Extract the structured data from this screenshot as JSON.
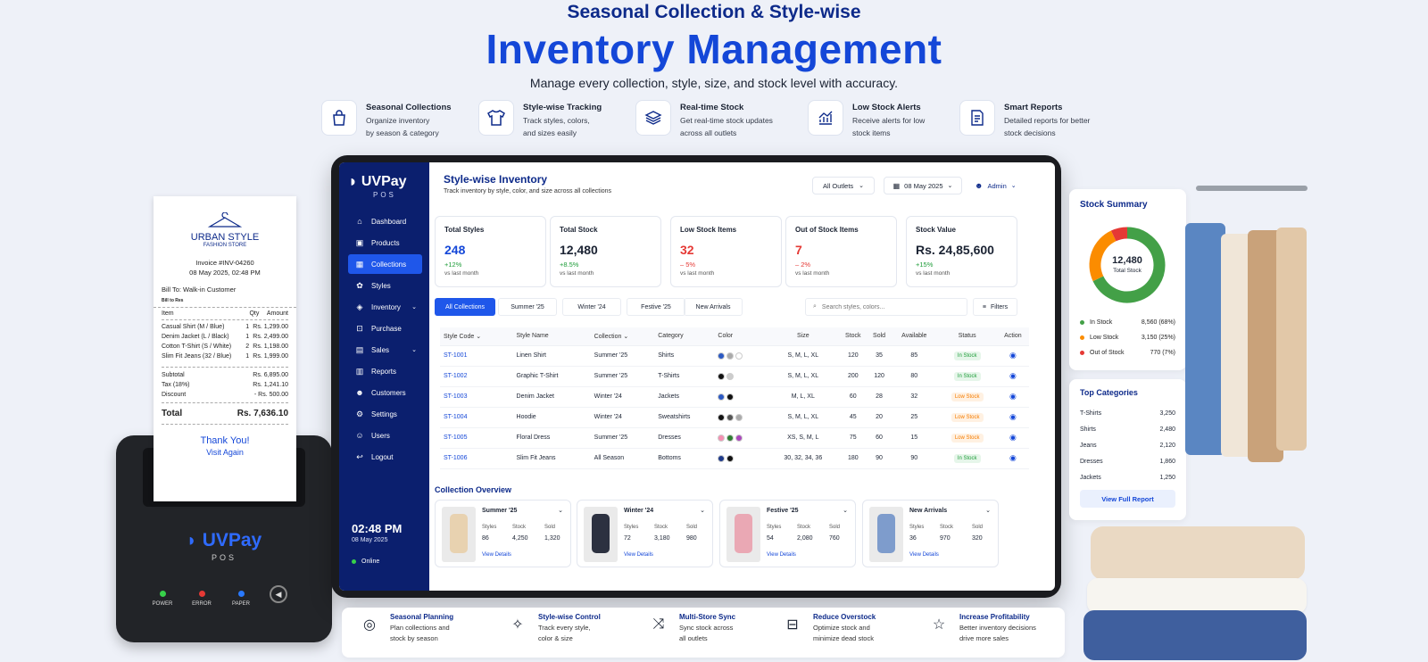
{
  "header": {
    "top_title": "Seasonal Collection & Style-wise",
    "main_title": "Inventory Management",
    "subtitle": "Manage every collection, style, size, and stock level with accuracy."
  },
  "features": [
    {
      "icon": "shopping-bag-icon",
      "title": "Seasonal Collections",
      "line1": "Organize inventory",
      "line2": "by season & category"
    },
    {
      "icon": "tshirt-icon",
      "title": "Style-wise Tracking",
      "line1": "Track styles, colors,",
      "line2": "and sizes easily"
    },
    {
      "icon": "layers-icon",
      "title": "Real-time Stock",
      "line1": "Get real-time stock updates",
      "line2": "across all outlets"
    },
    {
      "icon": "chart-up-icon",
      "title": "Low Stock Alerts",
      "line1": "Receive alerts for low",
      "line2": "stock items"
    },
    {
      "icon": "report-icon",
      "title": "Smart Reports",
      "line1": "Detailed reports for better",
      "line2": "stock decisions"
    }
  ],
  "receipt": {
    "store_name": "URBAN STYLE",
    "store_sub": "FASHION STORE",
    "invoice": "Invoice #INV-04260",
    "datetime": "08 May 2025, 02:48 PM",
    "bill_to": "Bill To: Walk-in Customer",
    "bill_details": "Bill to Res",
    "col_item": "Item",
    "col_qty": "Qty",
    "col_amount": "Amount",
    "items": [
      {
        "name": "Casual Shirt (M / Blue)",
        "qty": "1",
        "amount": "Rs. 1,299.00"
      },
      {
        "name": "Denim Jacket (L / Black)",
        "qty": "1",
        "amount": "Rs. 2,499.00"
      },
      {
        "name": "Cotton T-Shirt (S / White)",
        "qty": "2",
        "amount": "Rs. 1,198.00"
      },
      {
        "name": "Slim Fit Jeans (32 / Blue)",
        "qty": "1",
        "amount": "Rs. 1,999.00"
      }
    ],
    "subtotal_label": "Subtotal",
    "subtotal": "Rs. 6,895.00",
    "tax_label": "Tax (18%)",
    "tax": "Rs. 1,241.10",
    "discount_label": "Discount",
    "discount": "- Rs. 500.00",
    "total_label": "Total",
    "total": "Rs. 7,636.10",
    "thanks": "Thank You!",
    "visit": "Visit Again"
  },
  "printer": {
    "brand": "UVPay",
    "brand_sub": "POS",
    "lights": [
      {
        "label": "POWER",
        "color": "#37d14a"
      },
      {
        "label": "ERROR",
        "color": "#e53935"
      },
      {
        "label": "PAPER",
        "color": "#2979ff"
      }
    ]
  },
  "app": {
    "brand": "UVPay",
    "brand_sub": "POS",
    "nav": [
      {
        "label": "Dashboard",
        "icon": "home-icon",
        "glyph": "⌂",
        "active": false,
        "chevron": false
      },
      {
        "label": "Products",
        "icon": "box-icon",
        "glyph": "▣",
        "active": false,
        "chevron": false
      },
      {
        "label": "Collections",
        "icon": "grid-icon",
        "glyph": "▦",
        "active": true,
        "chevron": false
      },
      {
        "label": "Styles",
        "icon": "palette-icon",
        "glyph": "✿",
        "active": false,
        "chevron": false
      },
      {
        "label": "Inventory",
        "icon": "cube-icon",
        "glyph": "◈",
        "active": false,
        "chevron": true
      },
      {
        "label": "Purchase",
        "icon": "cart-icon",
        "glyph": "⊡",
        "active": false,
        "chevron": false
      },
      {
        "label": "Sales",
        "icon": "tag-icon",
        "glyph": "▤",
        "active": false,
        "chevron": true
      },
      {
        "label": "Reports",
        "icon": "report-icon",
        "glyph": "▥",
        "active": false,
        "chevron": false
      },
      {
        "label": "Customers",
        "icon": "users-icon",
        "glyph": "☻",
        "active": false,
        "chevron": false
      },
      {
        "label": "Settings",
        "icon": "gear-icon",
        "glyph": "⚙",
        "active": false,
        "chevron": false
      },
      {
        "label": "Users",
        "icon": "user-group-icon",
        "glyph": "☺",
        "active": false,
        "chevron": false
      },
      {
        "label": "Logout",
        "icon": "logout-icon",
        "glyph": "↩",
        "active": false,
        "chevron": false
      }
    ],
    "clock_time": "02:48 PM",
    "clock_date": "08 May 2025",
    "status": "Online",
    "page_title": "Style-wise Inventory",
    "page_subtitle": "Track inventory by style, color, and size across all collections",
    "outlet_select": "All Outlets",
    "date_select": "08 May 2025",
    "user": "Admin",
    "stats": [
      {
        "label": "Total Styles",
        "value": "248",
        "change": "+12%",
        "sub": "vs last month",
        "color": "#1447d8",
        "change_color": "#1f9d3a"
      },
      {
        "label": "Total Stock",
        "value": "12,480",
        "change": "+8.5%",
        "sub": "vs last month",
        "color": "#1b2333",
        "change_color": "#1f9d3a"
      },
      {
        "label": "Low Stock Items",
        "value": "32",
        "change": "– 5%",
        "sub": "vs last month",
        "color": "#e53935",
        "change_color": "#e53935"
      },
      {
        "label": "Out of Stock Items",
        "value": "7",
        "change": "– 2%",
        "sub": "vs last month",
        "color": "#e53935",
        "change_color": "#e53935"
      },
      {
        "label": "Stock Value",
        "value": "Rs. 24,85,600",
        "change": "+15%",
        "sub": "vs last month",
        "color": "#1b2333",
        "change_color": "#1f9d3a"
      }
    ],
    "tabs": [
      "All Collections",
      "Summer '25",
      "Winter '24",
      "Festive '25",
      "New Arrivals"
    ],
    "search_placeholder": "Search styles, colors...",
    "filters_label": "Filters",
    "columns": [
      "Style Code",
      "Style Name",
      "Collection",
      "Category",
      "Color",
      "Size",
      "Stock",
      "Sold",
      "Available",
      "Status",
      "Action"
    ],
    "rows": [
      {
        "code": "ST-1001",
        "name": "Linen Shirt",
        "collection": "Summer '25",
        "category": "Shirts",
        "colors": [
          "#2b59c3",
          "#aaaaaa",
          "#ffffff"
        ],
        "size": "S, M, L, XL",
        "stock": "120",
        "sold": "35",
        "available": "85",
        "status": "In Stock",
        "status_type": "in"
      },
      {
        "code": "ST-1002",
        "name": "Graphic T-Shirt",
        "collection": "Summer '25",
        "category": "T-Shirts",
        "colors": [
          "#111111",
          "#cccccc"
        ],
        "size": "S, M, L, XL",
        "stock": "200",
        "sold": "120",
        "available": "80",
        "status": "In Stock",
        "status_type": "in"
      },
      {
        "code": "ST-1003",
        "name": "Denim Jacket",
        "collection": "Winter '24",
        "category": "Jackets",
        "colors": [
          "#2b59c3",
          "#111111"
        ],
        "size": "M, L, XL",
        "stock": "60",
        "sold": "28",
        "available": "32",
        "status": "Low Stock",
        "status_type": "low"
      },
      {
        "code": "ST-1004",
        "name": "Hoodie",
        "collection": "Winter '24",
        "category": "Sweatshirts",
        "colors": [
          "#111111",
          "#555555",
          "#aaaaaa"
        ],
        "size": "S, M, L, XL",
        "stock": "45",
        "sold": "20",
        "available": "25",
        "status": "Low Stock",
        "status_type": "low"
      },
      {
        "code": "ST-1005",
        "name": "Floral Dress",
        "collection": "Summer '25",
        "category": "Dresses",
        "colors": [
          "#f48fb1",
          "#2e7d32",
          "#ab47bc"
        ],
        "size": "XS, S, M, L",
        "stock": "75",
        "sold": "60",
        "available": "15",
        "status": "Low Stock",
        "status_type": "low"
      },
      {
        "code": "ST-1006",
        "name": "Slim Fit Jeans",
        "collection": "All Season",
        "category": "Bottoms",
        "colors": [
          "#1e3a8a",
          "#111111"
        ],
        "size": "30, 32, 34, 36",
        "stock": "180",
        "sold": "90",
        "available": "90",
        "status": "In Stock",
        "status_type": "in"
      }
    ],
    "overview_title": "Collection Overview",
    "overview_labels": {
      "styles": "Styles",
      "stock": "Stock",
      "sold": "Sold",
      "details": "View Details"
    },
    "collections": [
      {
        "name": "Summer '25",
        "styles": "86",
        "stock": "4,250",
        "sold": "1,320",
        "swatch": "#e8d2b0"
      },
      {
        "name": "Winter '24",
        "styles": "72",
        "stock": "3,180",
        "sold": "980",
        "swatch": "#2c3140"
      },
      {
        "name": "Festive '25",
        "styles": "54",
        "stock": "2,080",
        "sold": "760",
        "swatch": "#eaa8b4"
      },
      {
        "name": "New Arrivals",
        "styles": "36",
        "stock": "970",
        "sold": "320",
        "swatch": "#7e9ccc"
      }
    ]
  },
  "stock_summary": {
    "title": "Stock Summary",
    "center_value": "12,480",
    "center_label": "Total Stock",
    "segments": [
      {
        "label": "In Stock",
        "value": "8,560 (68%)",
        "fraction": 0.68,
        "color": "#43a047"
      },
      {
        "label": "Low Stock",
        "value": "3,150 (25%)",
        "fraction": 0.25,
        "color": "#fb8c00"
      },
      {
        "label": "Out of Stock",
        "value": "770 (7%)",
        "fraction": 0.07,
        "color": "#e53935"
      }
    ]
  },
  "top_categories": {
    "title": "Top Categories",
    "items": [
      {
        "name": "T-Shirts",
        "value": "3,250"
      },
      {
        "name": "Shirts",
        "value": "2,480"
      },
      {
        "name": "Jeans",
        "value": "2,120"
      },
      {
        "name": "Dresses",
        "value": "1,860"
      },
      {
        "name": "Jackets",
        "value": "1,250"
      }
    ],
    "button": "View Full Report"
  },
  "bottom_features": [
    {
      "icon": "target-icon",
      "title": "Seasonal Planning",
      "line1": "Plan collections and",
      "line2": "stock by season"
    },
    {
      "icon": "style-icon",
      "title": "Style-wise Control",
      "line1": "Track every style,",
      "line2": "color & size"
    },
    {
      "icon": "share-icon",
      "title": "Multi-Store Sync",
      "line1": "Sync stock across",
      "line2": "all outlets"
    },
    {
      "icon": "box-down-icon",
      "title": "Reduce Overstock",
      "line1": "Optimize stock and",
      "line2": "minimize dead stock"
    },
    {
      "icon": "star-icon",
      "title": "Increase Profitability",
      "line1": "Better inventory decisions",
      "line2": "drive more sales"
    }
  ]
}
